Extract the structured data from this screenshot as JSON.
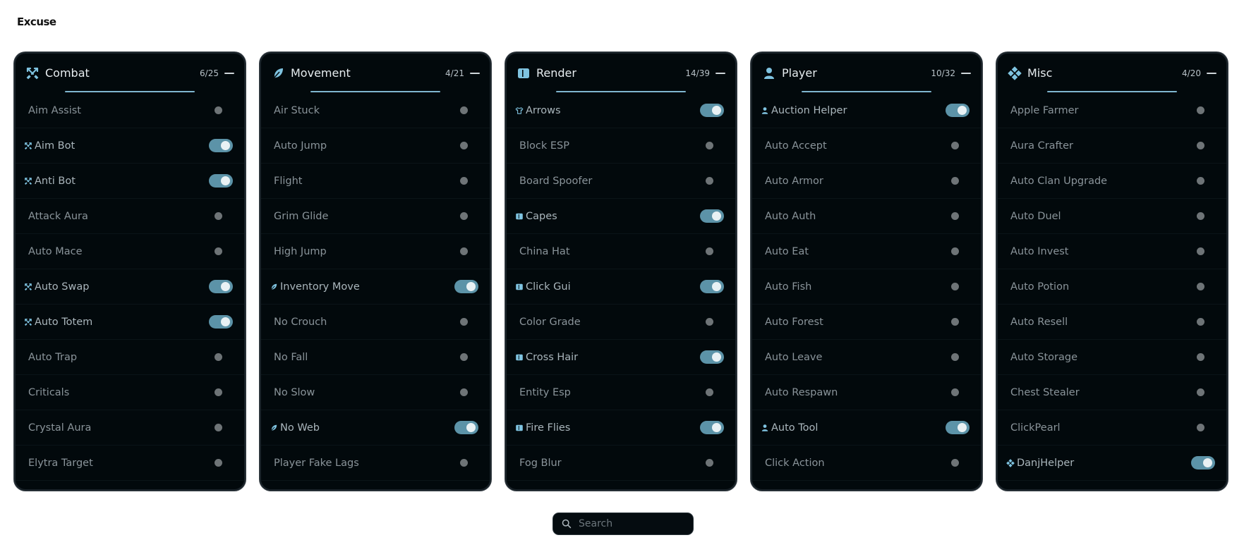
{
  "brand": {
    "name": "Excuse"
  },
  "search": {
    "placeholder": "Search"
  },
  "panels": [
    {
      "id": "combat",
      "title": "Combat",
      "count": "6/25",
      "icon": "swords-icon",
      "modules": [
        {
          "name": "Aim Assist",
          "enabled": false
        },
        {
          "name": "Aim Bot",
          "enabled": true
        },
        {
          "name": "Anti Bot",
          "enabled": true
        },
        {
          "name": "Attack Aura",
          "enabled": false
        },
        {
          "name": "Auto Mace",
          "enabled": false
        },
        {
          "name": "Auto Swap",
          "enabled": true
        },
        {
          "name": "Auto Totem",
          "enabled": true
        },
        {
          "name": "Auto Trap",
          "enabled": false
        },
        {
          "name": "Criticals",
          "enabled": false
        },
        {
          "name": "Crystal Aura",
          "enabled": false
        },
        {
          "name": "Elytra Target",
          "enabled": false
        }
      ]
    },
    {
      "id": "movement",
      "title": "Movement",
      "count": "4/21",
      "icon": "feather-icon",
      "modules": [
        {
          "name": "Air Stuck",
          "enabled": false
        },
        {
          "name": "Auto Jump",
          "enabled": false
        },
        {
          "name": "Flight",
          "enabled": false
        },
        {
          "name": "Grim Glide",
          "enabled": false
        },
        {
          "name": "High Jump",
          "enabled": false
        },
        {
          "name": "Inventory Move",
          "enabled": true
        },
        {
          "name": "No Crouch",
          "enabled": false
        },
        {
          "name": "No Fall",
          "enabled": false
        },
        {
          "name": "No Slow",
          "enabled": false
        },
        {
          "name": "No Web",
          "enabled": true
        },
        {
          "name": "Player Fake Lags",
          "enabled": false
        }
      ]
    },
    {
      "id": "render",
      "title": "Render",
      "count": "14/39",
      "icon": "layout-icon",
      "modules": [
        {
          "name": "Arrows",
          "enabled": true
        },
        {
          "name": "Block ESP",
          "enabled": false
        },
        {
          "name": "Board Spoofer",
          "enabled": false
        },
        {
          "name": "Capes",
          "enabled": true
        },
        {
          "name": "China Hat",
          "enabled": false
        },
        {
          "name": "Click Gui",
          "enabled": true
        },
        {
          "name": "Color Grade",
          "enabled": false
        },
        {
          "name": "Cross Hair",
          "enabled": true
        },
        {
          "name": "Entity Esp",
          "enabled": false
        },
        {
          "name": "Fire Flies",
          "enabled": true
        },
        {
          "name": "Fog Blur",
          "enabled": false
        }
      ]
    },
    {
      "id": "player",
      "title": "Player",
      "count": "10/32",
      "icon": "person-icon",
      "modules": [
        {
          "name": "Auction Helper",
          "enabled": true
        },
        {
          "name": "Auto Accept",
          "enabled": false
        },
        {
          "name": "Auto Armor",
          "enabled": false
        },
        {
          "name": "Auto Auth",
          "enabled": false
        },
        {
          "name": "Auto Eat",
          "enabled": false
        },
        {
          "name": "Auto Fish",
          "enabled": false
        },
        {
          "name": "Auto Forest",
          "enabled": false
        },
        {
          "name": "Auto Leave",
          "enabled": false
        },
        {
          "name": "Auto Respawn",
          "enabled": false
        },
        {
          "name": "Auto Tool",
          "enabled": true
        },
        {
          "name": "Click Action",
          "enabled": false
        }
      ]
    },
    {
      "id": "misc",
      "title": "Misc",
      "count": "4/20",
      "icon": "diamonds-icon",
      "modules": [
        {
          "name": "Apple Farmer",
          "enabled": false
        },
        {
          "name": "Aura Crafter",
          "enabled": false
        },
        {
          "name": "Auto Clan Upgrade",
          "enabled": false
        },
        {
          "name": "Auto Duel",
          "enabled": false
        },
        {
          "name": "Auto Invest",
          "enabled": false
        },
        {
          "name": "Auto Potion",
          "enabled": false
        },
        {
          "name": "Auto Resell",
          "enabled": false
        },
        {
          "name": "Auto Storage",
          "enabled": false
        },
        {
          "name": "Chest Stealer",
          "enabled": false
        },
        {
          "name": "ClickPearl",
          "enabled": false
        },
        {
          "name": "DanjHelper",
          "enabled": true
        }
      ]
    }
  ]
}
